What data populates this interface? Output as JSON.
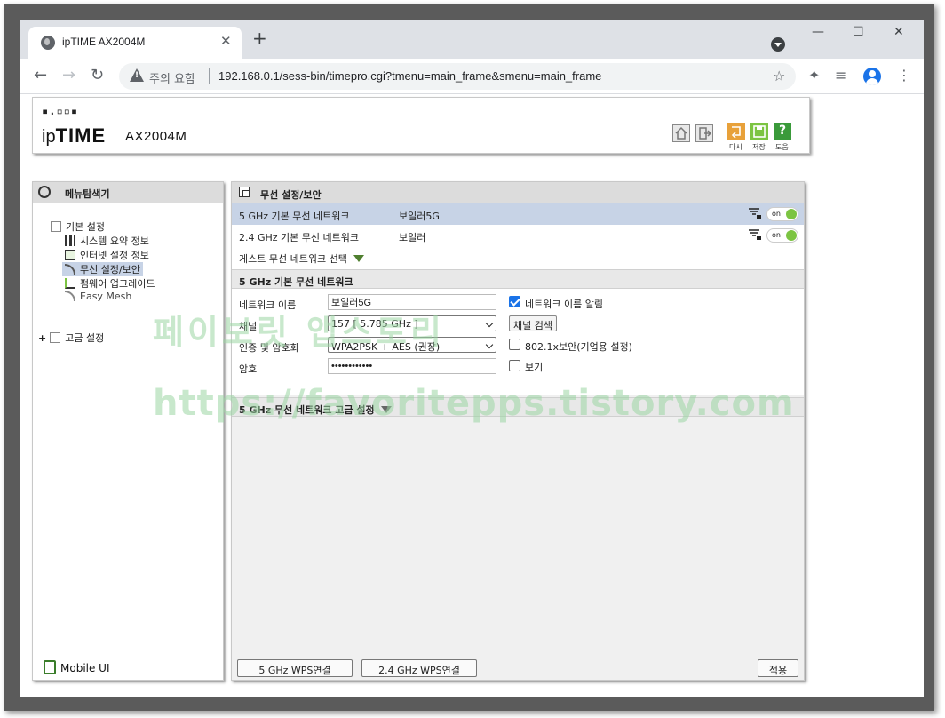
{
  "browser": {
    "tab_title": "ipTIME AX2004M",
    "tab_close": "✕",
    "new_tab": "+",
    "security_warning": "주의 요함",
    "url": "192.168.0.1/sess-bin/timepro.cgi?tmenu=main_frame&smenu=main_frame",
    "window_controls": [
      "—",
      "☐",
      "✕"
    ]
  },
  "header": {
    "logo_dots": "▪.▫▫▪",
    "brand_prefix": "ip",
    "brand_main": "TIME",
    "model": "AX2004M",
    "actions": [
      "다시",
      "저장",
      "도움"
    ]
  },
  "menu": {
    "title": "메뉴탐색기",
    "basic_group": "기본 설정",
    "basic_items": [
      "시스템 요약 정보",
      "인터넷 설정 정보",
      "무선 설정/보안",
      "펌웨어 업그레이드",
      "Easy Mesh"
    ],
    "advanced_group": "고급 설정",
    "advanced_plus": "+",
    "mobile_ui": "Mobile UI"
  },
  "content": {
    "title": "무선 설정/보안",
    "networks": [
      {
        "band": "5 GHz 기본 무선 네트워크",
        "ssid": "보일러5G",
        "toggle": "on",
        "selected": true
      },
      {
        "band": "2.4 GHz 기본 무선 네트워크",
        "ssid": "보일러",
        "toggle": "on",
        "selected": false
      }
    ],
    "guest_select": "게스트 무선 네트워크 선택",
    "section_title": "5 GHz 기본 무선 네트워크",
    "form": {
      "ssid_label": "네트워크 이름",
      "ssid_value": "보일러5G",
      "broadcast_label": "네트워크 이름 알림",
      "broadcast_checked": true,
      "channel_label": "채널",
      "channel_value": "157 [ 5.785 GHz ]",
      "channel_search": "채널 검색",
      "auth_label": "인증 및 암호화",
      "auth_value": "WPA2PSK + AES (권장)",
      "enterprise_label": "802.1x보안(기업용 설정)",
      "enterprise_checked": false,
      "password_label": "암호",
      "password_value": "••••••••••••",
      "show_label": "보기",
      "show_checked": false
    },
    "advanced_section": "5 GHz 무선 네트워크 고급 설정",
    "wps_5g": "5 GHz WPS연결",
    "wps_24g": "2.4 GHz WPS연결",
    "apply": "적용"
  },
  "watermark": {
    "line1": "페이보릿 앱스토리",
    "line2": "https://favoritepps.tistory.com"
  },
  "colors": {
    "selected_row": "#c7d3e6",
    "toggle_on": "#7cc442",
    "header_gray": "#dcdcdc",
    "frame": "#5b5b5b",
    "chrome_accent": "#1a73e8"
  }
}
